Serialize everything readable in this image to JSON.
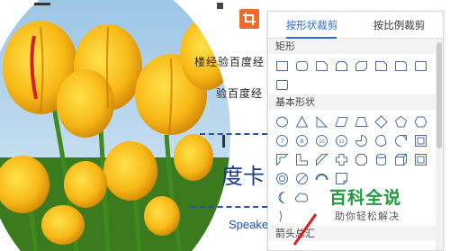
{
  "document": {
    "line1": "楼经验百度经",
    "line2": "验百度经",
    "big_text": "度卡",
    "speaker_text": "Speake"
  },
  "toolbar": {
    "crop_icon": "crop-icon"
  },
  "crop_panel": {
    "tabs": [
      {
        "label": "按形状裁剪",
        "active": true
      },
      {
        "label": "按比例裁剪",
        "active": false
      }
    ],
    "sections": [
      {
        "title": "矩形",
        "rows": 2
      },
      {
        "title": "基本形状",
        "rows": 6
      },
      {
        "title": "箭头总汇",
        "rows": 0
      }
    ]
  },
  "watermark": {
    "brand": "百科全说",
    "slogan": "助你轻松解决"
  },
  "colors": {
    "accent": "#2a6ed9",
    "crop_button": "#f06a28",
    "brand_green": "#1e9b3c",
    "dash_blue": "#2b4fb0"
  }
}
